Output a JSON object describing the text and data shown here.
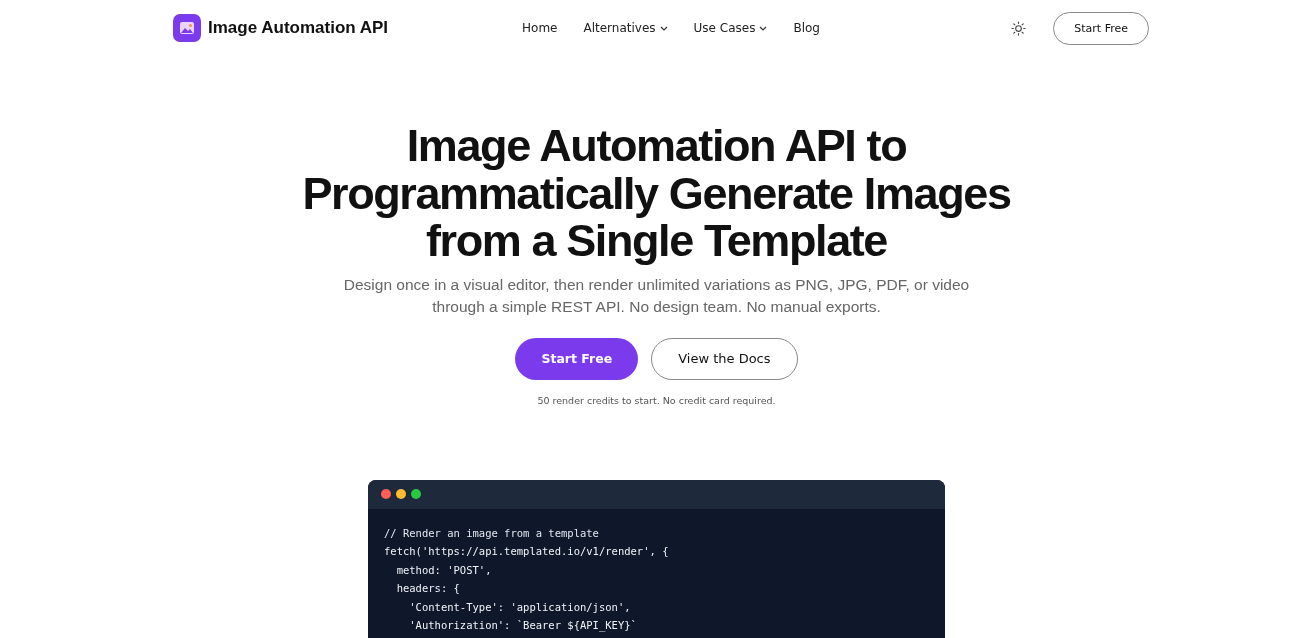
{
  "nav": {
    "brand": "Image Automation API",
    "links": [
      {
        "label": "Home",
        "dropdown": false
      },
      {
        "label": "Alternatives",
        "dropdown": true
      },
      {
        "label": "Use Cases",
        "dropdown": true
      },
      {
        "label": "Blog",
        "dropdown": false
      }
    ],
    "cta": "Start Free"
  },
  "hero": {
    "title": [
      "Image Automation API to",
      "Programmatically Generate Images",
      "from a Single Template"
    ],
    "subtitle": [
      "Design once in a visual editor, then render unlimited variations as PNG, JPG, PDF, or video",
      "through a simple REST API. No design team. No manual exports."
    ],
    "primary_button": "Start Free",
    "secondary_button": "View the Docs",
    "note": "50 render credits to start. No credit card required."
  },
  "code_window": {
    "lines": [
      {
        "text": "// Render an image from a template",
        "kind": "comment"
      },
      {
        "text": "fetch('https://api.templated.io/v1/render', {",
        "kind": "code"
      },
      {
        "text": "  method: 'POST',",
        "kind": "code"
      },
      {
        "text": "  headers: {",
        "kind": "code"
      },
      {
        "text": "    'Content-Type': 'application/json',",
        "kind": "code"
      },
      {
        "text": "    'Authorization': `Bearer ${API_KEY}`",
        "kind": "code"
      }
    ]
  }
}
